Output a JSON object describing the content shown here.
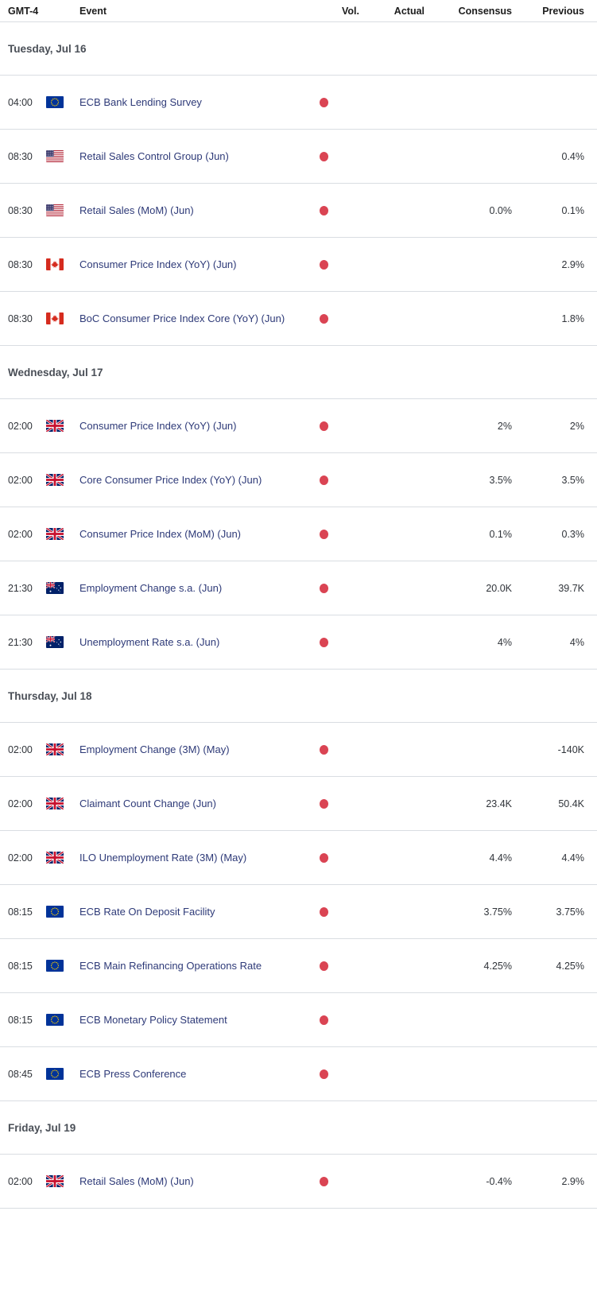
{
  "header": {
    "time_label": "GMT-4",
    "event_label": "Event",
    "vol_label": "Vol.",
    "actual_label": "Actual",
    "consensus_label": "Consensus",
    "previous_label": "Previous"
  },
  "colors": {
    "volatility_high": "#da4453",
    "event_link": "#2e3a78",
    "row_border": "#d9dde2",
    "day_label": "#4a4f57",
    "background": "#ffffff"
  },
  "icons": {
    "volatility": "volatility-dot-high"
  },
  "days": [
    {
      "label": "Tuesday, Jul 16",
      "events": [
        {
          "time": "04:00",
          "flag": "eu",
          "flag_name": "european-union-flag",
          "event": "ECB Bank Lending Survey",
          "vol": "high",
          "actual": "",
          "consensus": "",
          "previous": ""
        },
        {
          "time": "08:30",
          "flag": "us",
          "flag_name": "united-states-flag",
          "event": "Retail Sales Control Group (Jun)",
          "vol": "high",
          "actual": "",
          "consensus": "",
          "previous": "0.4%"
        },
        {
          "time": "08:30",
          "flag": "us",
          "flag_name": "united-states-flag",
          "event": "Retail Sales (MoM) (Jun)",
          "vol": "high",
          "actual": "",
          "consensus": "0.0%",
          "previous": "0.1%"
        },
        {
          "time": "08:30",
          "flag": "ca",
          "flag_name": "canada-flag",
          "event": "Consumer Price Index (YoY) (Jun)",
          "vol": "high",
          "actual": "",
          "consensus": "",
          "previous": "2.9%"
        },
        {
          "time": "08:30",
          "flag": "ca",
          "flag_name": "canada-flag",
          "event": "BoC Consumer Price Index Core (YoY) (Jun)",
          "vol": "high",
          "actual": "",
          "consensus": "",
          "previous": "1.8%"
        }
      ]
    },
    {
      "label": "Wednesday, Jul 17",
      "events": [
        {
          "time": "02:00",
          "flag": "gb",
          "flag_name": "united-kingdom-flag",
          "event": "Consumer Price Index (YoY) (Jun)",
          "vol": "high",
          "actual": "",
          "consensus": "2%",
          "previous": "2%"
        },
        {
          "time": "02:00",
          "flag": "gb",
          "flag_name": "united-kingdom-flag",
          "event": "Core Consumer Price Index (YoY) (Jun)",
          "vol": "high",
          "actual": "",
          "consensus": "3.5%",
          "previous": "3.5%"
        },
        {
          "time": "02:00",
          "flag": "gb",
          "flag_name": "united-kingdom-flag",
          "event": "Consumer Price Index (MoM) (Jun)",
          "vol": "high",
          "actual": "",
          "consensus": "0.1%",
          "previous": "0.3%"
        },
        {
          "time": "21:30",
          "flag": "au",
          "flag_name": "australia-flag",
          "event": "Employment Change s.a. (Jun)",
          "vol": "high",
          "actual": "",
          "consensus": "20.0K",
          "previous": "39.7K"
        },
        {
          "time": "21:30",
          "flag": "au",
          "flag_name": "australia-flag",
          "event": "Unemployment Rate s.a. (Jun)",
          "vol": "high",
          "actual": "",
          "consensus": "4%",
          "previous": "4%"
        }
      ]
    },
    {
      "label": "Thursday, Jul 18",
      "events": [
        {
          "time": "02:00",
          "flag": "gb",
          "flag_name": "united-kingdom-flag",
          "event": "Employment Change (3M) (May)",
          "vol": "high",
          "actual": "",
          "consensus": "",
          "previous": "-140K"
        },
        {
          "time": "02:00",
          "flag": "gb",
          "flag_name": "united-kingdom-flag",
          "event": "Claimant Count Change (Jun)",
          "vol": "high",
          "actual": "",
          "consensus": "23.4K",
          "previous": "50.4K"
        },
        {
          "time": "02:00",
          "flag": "gb",
          "flag_name": "united-kingdom-flag",
          "event": "ILO Unemployment Rate (3M) (May)",
          "vol": "high",
          "actual": "",
          "consensus": "4.4%",
          "previous": "4.4%"
        },
        {
          "time": "08:15",
          "flag": "eu",
          "flag_name": "european-union-flag",
          "event": "ECB Rate On Deposit Facility",
          "vol": "high",
          "actual": "",
          "consensus": "3.75%",
          "previous": "3.75%"
        },
        {
          "time": "08:15",
          "flag": "eu",
          "flag_name": "european-union-flag",
          "event": "ECB Main Refinancing Operations Rate",
          "vol": "high",
          "actual": "",
          "consensus": "4.25%",
          "previous": "4.25%"
        },
        {
          "time": "08:15",
          "flag": "eu",
          "flag_name": "european-union-flag",
          "event": "ECB Monetary Policy Statement",
          "vol": "high",
          "actual": "",
          "consensus": "",
          "previous": ""
        },
        {
          "time": "08:45",
          "flag": "eu",
          "flag_name": "european-union-flag",
          "event": "ECB Press Conference",
          "vol": "high",
          "actual": "",
          "consensus": "",
          "previous": ""
        }
      ]
    },
    {
      "label": "Friday, Jul 19",
      "events": [
        {
          "time": "02:00",
          "flag": "gb",
          "flag_name": "united-kingdom-flag",
          "event": "Retail Sales (MoM) (Jun)",
          "vol": "high",
          "actual": "",
          "consensus": "-0.4%",
          "previous": "2.9%"
        }
      ]
    }
  ]
}
